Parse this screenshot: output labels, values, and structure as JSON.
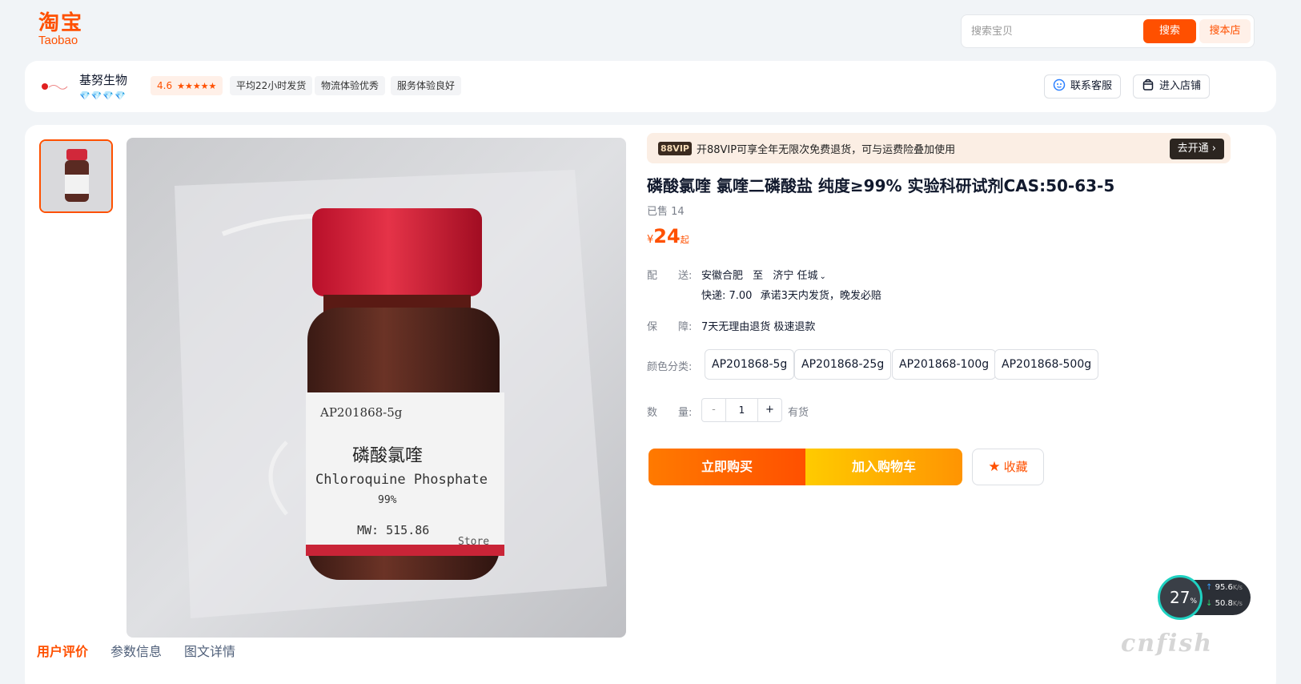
{
  "header": {
    "logo_cn": "淘宝",
    "logo_en": "Taobao",
    "search_placeholder": "搜索宝贝",
    "search_button": "搜索",
    "search_shop_button": "搜本店"
  },
  "shop": {
    "name": "基努生物",
    "diamonds": "💎💎💎💎",
    "rating_score": "4.6",
    "rating_stars": "★★★★★",
    "tags": [
      "平均22小时发货",
      "物流体验优秀",
      "服务体验良好"
    ],
    "contact_button": "联系客服",
    "enter_shop_button": "进入店铺"
  },
  "product": {
    "vip_badge": "88VIP",
    "vip_text": "开88VIP可享全年无限次免费退货，可与运费险叠加使用",
    "vip_button": "去开通 ›",
    "title": "磷酸氯喹 氯喹二磷酸盐 纯度≥99% 实验科研试剂CAS:50-63-5",
    "sold": "已售 14",
    "price_currency": "¥",
    "price_value": "24",
    "price_suffix": "起",
    "shipping_label": "配　　送:",
    "shipping_from": "安徽合肥",
    "shipping_to_word": "至",
    "shipping_to": "济宁 任城",
    "express": "快递: 7.00",
    "express_note": "承诺3天内发货，晚发必赔",
    "guarantee_label": "保　　障:",
    "guarantee": "7天无理由退货 极速退款",
    "sku_label": "颜色分类:",
    "skus": [
      "AP201868-5g",
      "AP201868-25g",
      "AP201868-100g",
      "AP201868-500g"
    ],
    "qty_label": "数　　量:",
    "qty_minus": "-",
    "qty_value": "1",
    "qty_plus": "+",
    "stock": "有货",
    "buy_button": "立即购买",
    "cart_button": "加入购物车",
    "fav_button": "收藏",
    "label_code": "AP201868-5g",
    "label_cn": "磷酸氯喹",
    "label_en": "Chloroquine Phosphate",
    "label_purity": "99%",
    "label_mw": "MW: 515.86",
    "label_store": "Store"
  },
  "tabs": [
    "用户评价",
    "参数信息",
    "图文详情"
  ],
  "speed_widget": {
    "percent": "27",
    "percent_unit": "%",
    "up": "95.6",
    "down": "50.8",
    "unit": "K/s"
  },
  "watermark": "cnfish",
  "colors": {
    "brand": "#ff5000",
    "bg": "#f1f4f7"
  }
}
